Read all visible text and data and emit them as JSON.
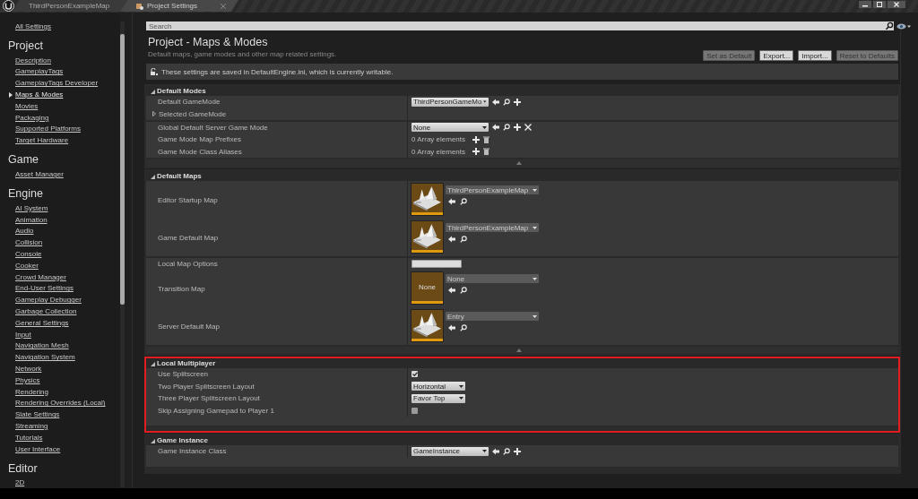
{
  "tabs": [
    {
      "label": "ThirdPersonExampleMap",
      "selected": false
    },
    {
      "label": "Project Settings",
      "selected": true
    }
  ],
  "search": {
    "placeholder": "Search"
  },
  "sidebar": {
    "items": [
      {
        "kind": "link",
        "label": "All Settings",
        "selected": false
      },
      {
        "kind": "heading",
        "label": "Project"
      },
      {
        "kind": "link",
        "label": "Description",
        "selected": false
      },
      {
        "kind": "link",
        "label": "GameplayTags",
        "selected": false
      },
      {
        "kind": "link",
        "label": "GameplayTags Developer",
        "selected": false
      },
      {
        "kind": "link",
        "label": "Maps & Modes",
        "selected": true
      },
      {
        "kind": "link",
        "label": "Movies",
        "selected": false
      },
      {
        "kind": "link",
        "label": "Packaging",
        "selected": false
      },
      {
        "kind": "link",
        "label": "Supported Platforms",
        "selected": false
      },
      {
        "kind": "link",
        "label": "Target Hardware",
        "selected": false
      },
      {
        "kind": "heading",
        "label": "Game"
      },
      {
        "kind": "link",
        "label": "Asset Manager",
        "selected": false
      },
      {
        "kind": "heading",
        "label": "Engine"
      },
      {
        "kind": "link",
        "label": "AI System",
        "selected": false
      },
      {
        "kind": "link",
        "label": "Animation",
        "selected": false
      },
      {
        "kind": "link",
        "label": "Audio",
        "selected": false
      },
      {
        "kind": "link",
        "label": "Collision",
        "selected": false
      },
      {
        "kind": "link",
        "label": "Console",
        "selected": false
      },
      {
        "kind": "link",
        "label": "Cooker",
        "selected": false
      },
      {
        "kind": "link",
        "label": "Crowd Manager",
        "selected": false
      },
      {
        "kind": "link",
        "label": "End-User Settings",
        "selected": false
      },
      {
        "kind": "link",
        "label": "Gameplay Debugger",
        "selected": false
      },
      {
        "kind": "link",
        "label": "Garbage Collection",
        "selected": false
      },
      {
        "kind": "link",
        "label": "General Settings",
        "selected": false
      },
      {
        "kind": "link",
        "label": "Input",
        "selected": false
      },
      {
        "kind": "link",
        "label": "Navigation Mesh",
        "selected": false
      },
      {
        "kind": "link",
        "label": "Navigation System",
        "selected": false
      },
      {
        "kind": "link",
        "label": "Network",
        "selected": false
      },
      {
        "kind": "link",
        "label": "Physics",
        "selected": false
      },
      {
        "kind": "link",
        "label": "Rendering",
        "selected": false
      },
      {
        "kind": "link",
        "label": "Rendering Overrides (Local)",
        "selected": false
      },
      {
        "kind": "link",
        "label": "Slate Settings",
        "selected": false
      },
      {
        "kind": "link",
        "label": "Streaming",
        "selected": false
      },
      {
        "kind": "link",
        "label": "Tutorials",
        "selected": false
      },
      {
        "kind": "link",
        "label": "User Interface",
        "selected": false
      },
      {
        "kind": "heading",
        "label": "Editor"
      },
      {
        "kind": "link",
        "label": "2D",
        "selected": false
      }
    ]
  },
  "page": {
    "title": "Project - Maps & Modes",
    "subtitle": "Default maps, game modes and other map related settings.",
    "buttons": [
      {
        "label": "Set as Default",
        "disabled": true
      },
      {
        "label": "Export...",
        "disabled": false
      },
      {
        "label": "Import...",
        "disabled": false
      },
      {
        "label": "Reset to Defaults",
        "disabled": true
      }
    ],
    "notice": "These settings are saved in DefaultEngine.ini, which is currently writable."
  },
  "sections": [
    {
      "title": "Default Modes",
      "expanded": true,
      "highlighted": false,
      "footer_arrow": true,
      "groups": [
        [
          {
            "kind": "class",
            "label": "Default GameMode",
            "value": "ThirdPersonGameMo",
            "clearable": false
          },
          {
            "kind": "expander",
            "label": "Selected GameMode",
            "expanded": false
          }
        ],
        [
          {
            "kind": "class",
            "label": "Global Default Server Game Mode",
            "value": "None",
            "clearable": true
          },
          {
            "kind": "array",
            "label": "Game Mode Map Prefixes",
            "value": "0 Array elements"
          },
          {
            "kind": "array",
            "label": "Game Mode Class Aliases",
            "value": "0 Array elements"
          }
        ]
      ]
    },
    {
      "title": "Default Maps",
      "expanded": true,
      "highlighted": false,
      "footer_arrow": true,
      "groups": [
        [
          {
            "kind": "map",
            "label": "Editor Startup Map",
            "value": "ThirdPersonExampleMap"
          },
          {
            "kind": "map",
            "label": "Game Default Map",
            "value": "ThirdPersonExampleMap"
          }
        ],
        [
          {
            "kind": "text",
            "label": "Local Map Options"
          },
          {
            "kind": "map",
            "label": "Transition Map",
            "value": "None",
            "thumb_label": "None"
          },
          {
            "kind": "map",
            "label": "Server Default Map",
            "value": "Entry"
          }
        ]
      ]
    },
    {
      "title": "Local Multiplayer",
      "expanded": true,
      "highlighted": true,
      "footer_arrow": false,
      "groups": [
        [
          {
            "kind": "checkbox",
            "label": "Use Splitscreen",
            "checked": true
          },
          {
            "kind": "enum",
            "label": "Two Player Splitscreen Layout",
            "value": "Horizontal"
          },
          {
            "kind": "enum",
            "label": "Three Player Splitscreen Layout",
            "value": "Favor Top"
          },
          {
            "kind": "checkbox",
            "label": "Skip Assigning Gamepad to Player 1",
            "checked": false
          }
        ]
      ]
    },
    {
      "title": "Game Instance",
      "expanded": true,
      "highlighted": false,
      "footer_arrow": false,
      "groups": [
        [
          {
            "kind": "class",
            "label": "Game Instance Class",
            "value": "GameInstance",
            "clearable": false
          }
        ]
      ]
    }
  ]
}
